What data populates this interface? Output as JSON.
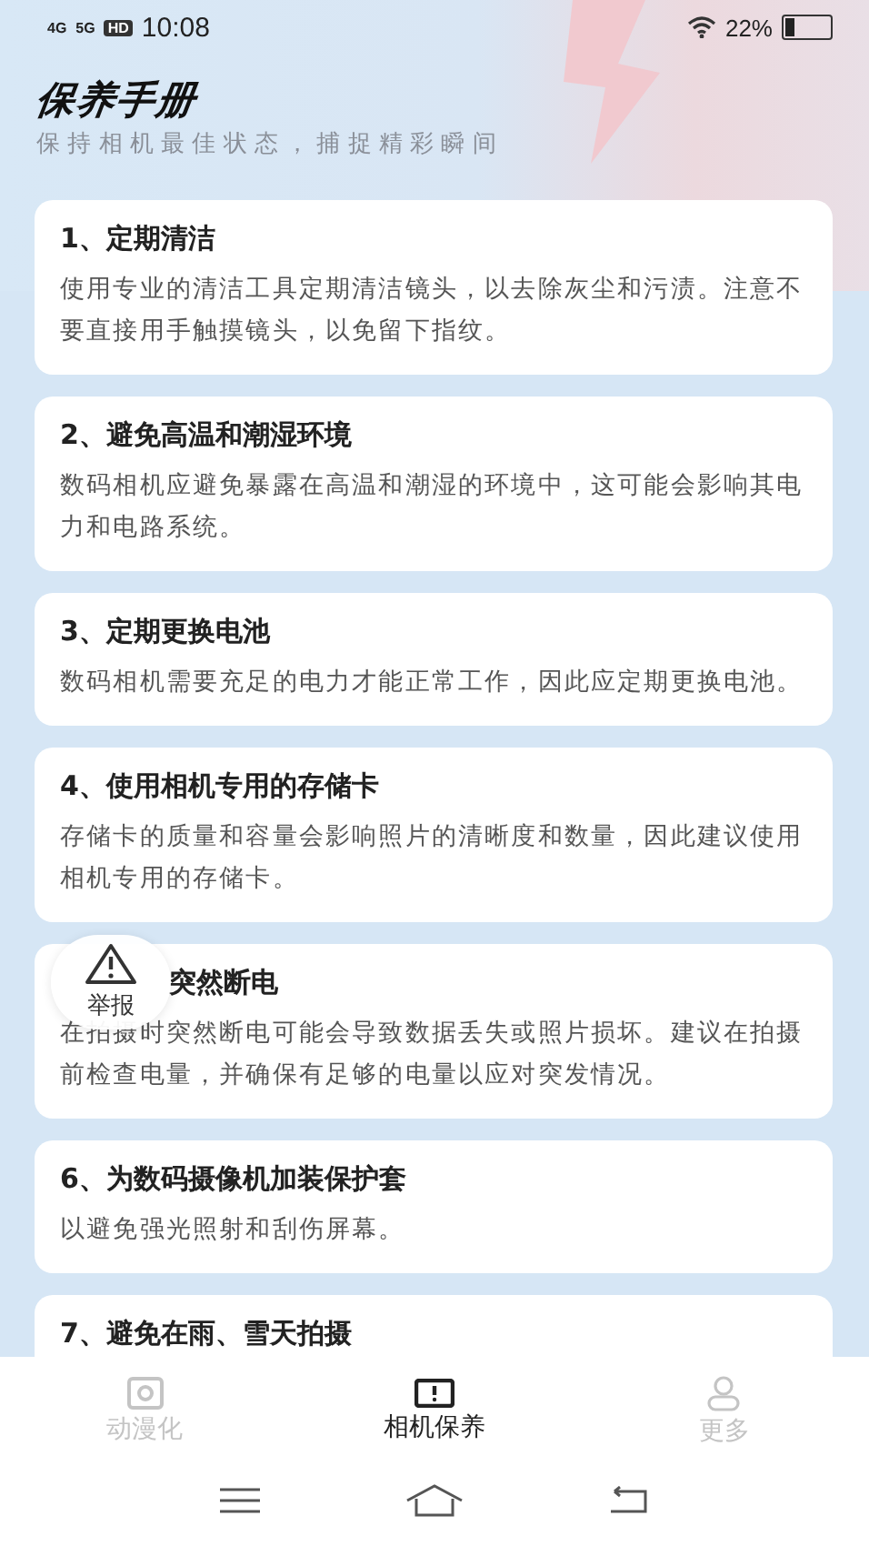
{
  "status_bar": {
    "network_1": "4G",
    "network_2": "5G",
    "sim": "HD",
    "time": "10:08",
    "battery": "22%"
  },
  "header": {
    "title": "保养手册",
    "subtitle": "保 持 相 机 最 佳 状 态 ， 捕 捉 精 彩 瞬 间"
  },
  "tips": [
    {
      "title": "1、定期清洁",
      "text": "使用专业的清洁工具定期清洁镜头，以去除灰尘和污渍。注意不要直接用手触摸镜头，以免留下指纹。"
    },
    {
      "title": "2、避免高温和潮湿环境",
      "text": "数码相机应避免暴露在高温和潮湿的环境中，这可能会影响其电力和电路系统。"
    },
    {
      "title": "3、定期更换电池",
      "text": "数码相机需要充足的电力才能正常工作，因此应定期更换电池。"
    },
    {
      "title": "4、使用相机专用的存储卡",
      "text": "存储卡的质量和容量会影响照片的清晰度和数量，因此建议使用相机专用的存储卡。"
    },
    {
      "title": "突然断电",
      "text": "在拍摄时突然断电可能会导致数据丢失或照片损坏。建议在拍摄前检查电量，并确保有足够的电量以应对突发情况。",
      "covered": true
    },
    {
      "title": "6、为数码摄像机加装保护套",
      "text": "以避免强光照射和刮伤屏幕。"
    },
    {
      "title": "7、避免在雨、雪天拍摄"
    }
  ],
  "report_button": {
    "label": "举报"
  },
  "tab_bar": [
    {
      "label": "动漫化",
      "selected": false
    },
    {
      "label": "相机保养",
      "selected": true
    },
    {
      "label": "更多",
      "selected": false
    }
  ]
}
